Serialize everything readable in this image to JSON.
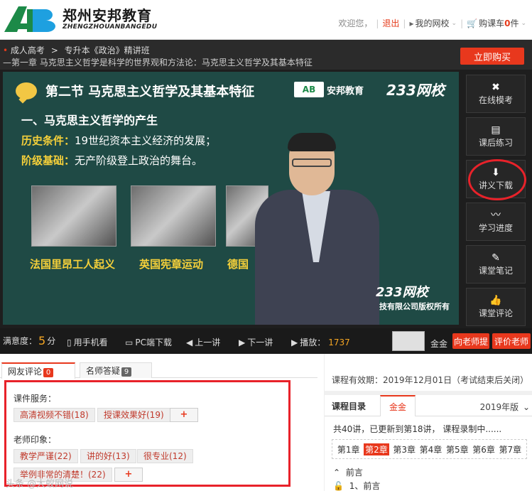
{
  "header": {
    "logo_cn": "郑州安邦教育",
    "logo_en": "ZHENGZHOUANBANGEDU",
    "welcome": "欢迎您，",
    "logout": "退出",
    "my_school": "我的网校",
    "cart_label": "购课车",
    "cart_count": "0",
    "cart_unit": "件"
  },
  "course_bar": {
    "breadcrumb_1": "成人高考",
    "breadcrumb_sep": ">",
    "breadcrumb_2": "专升本《政治》精讲班",
    "chapter_line": "—第一章 马克思主义哲学是科学的世界观和方法论：马克思主义哲学及其基本特征",
    "buy_button": "立即购买"
  },
  "video": {
    "slide_title": "第二节  马克思主义哲学及其基本特征",
    "brand_name": "安邦教育",
    "brand_233": "233网校",
    "sub_heading": "一、马克思主义哲学的产生",
    "line1_key": "历史条件：",
    "line1_text": "19世纪资本主义经济的发展；",
    "line2_key": "阶级基础：",
    "line2_text": "无产阶级登上政治的舞台。",
    "caption1": "法国里昂工人起义",
    "caption2": "英国宪章运动",
    "caption3": "德国",
    "watermark": "233网校",
    "copyright": "技有限公司版权所有"
  },
  "tools": [
    {
      "icon": "✖",
      "label": "在线模考"
    },
    {
      "icon": "▤",
      "label": "课后练习"
    },
    {
      "icon": "⬇",
      "label": "讲义下载"
    },
    {
      "icon": "〰",
      "label": "学习进度"
    },
    {
      "icon": "✎",
      "label": "课堂笔记"
    },
    {
      "icon": "👍",
      "label": "课堂评论"
    }
  ],
  "controls": {
    "satisfaction_label": "满意度：",
    "satisfaction_value": "5",
    "satisfaction_unit": "分",
    "mobile": "用手机看",
    "pc_download": "PC端下载",
    "prev": "上一讲",
    "next": "下一讲",
    "play_label": "播放：",
    "play_count": "1737",
    "teacher_name": "金金",
    "ask_teacher": "向老师提",
    "rate_teacher": "评价老师"
  },
  "left_panel": {
    "tab_reviews": "网友评论",
    "tab_reviews_count": "0",
    "tab_qa": "名师答疑",
    "tab_qa_count": "9",
    "group1_label": "课件服务：",
    "group1_chips": [
      "高清视频不错(18)",
      "授课效果好(19)"
    ],
    "group2_label": "老师印象：",
    "group2_chips": [
      "教学严谨(22)",
      "讲的好(13)",
      "很专业(12)",
      "举例非常的清楚！(22)"
    ],
    "plus": "+",
    "watermark": "头条 @大蚁网说"
  },
  "right_panel": {
    "validity": "课程有效期：2019年12月01日（考试结束后关闭）",
    "tab_catalog": "课程目录",
    "tab_teacher": "金金",
    "year_select": "2019年版",
    "progress_note": "共40讲，已更新到第18讲， 课程录制中......",
    "chapters": [
      "第1章",
      "第2章",
      "第3章",
      "第4章",
      "第5章",
      "第6章",
      "第7章"
    ],
    "active_chapter_index": 1,
    "toc_head": "前言",
    "toc_item": "1、前言"
  },
  "colors": {
    "accent": "#e8381d",
    "highlight_circle": "#e8222a",
    "slide_bg": "#1f4a45",
    "slide_key": "#f5d03a"
  }
}
